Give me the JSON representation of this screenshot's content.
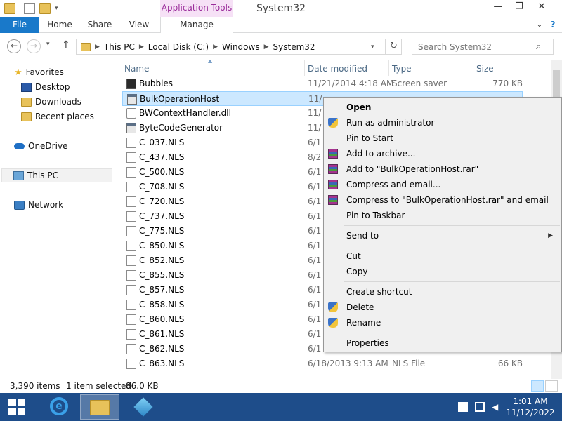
{
  "window": {
    "title": "System32",
    "app_tools": "Application Tools",
    "min_glyph": "—",
    "max_glyph": "❐",
    "close_glyph": "✕"
  },
  "ribbon": {
    "tabs": [
      "File",
      "Home",
      "Share",
      "View",
      "Manage"
    ],
    "help_glyph": "?"
  },
  "nav": {
    "back_glyph": "←",
    "forward_glyph": "→",
    "recent_glyph": "▾",
    "up_glyph": "↑",
    "breadcrumbs": [
      "This PC",
      "Local Disk (C:)",
      "Windows",
      "System32"
    ],
    "refresh_glyph": "↻",
    "search_placeholder": "Search System32"
  },
  "navpane": {
    "favorites": "Favorites",
    "desktop": "Desktop",
    "downloads": "Downloads",
    "recent_places": "Recent places",
    "onedrive": "OneDrive",
    "this_pc": "This PC",
    "network": "Network"
  },
  "columns": {
    "name": "Name",
    "date": "Date modified",
    "type": "Type",
    "size": "Size"
  },
  "files": [
    {
      "name": "Bubbles",
      "date": "11/21/2014 4:18 AM",
      "type": "Screen saver",
      "size": "770 KB",
      "icon": "scr"
    },
    {
      "name": "BulkOperationHost",
      "date": "11/",
      "type": "",
      "size": "",
      "icon": "app"
    },
    {
      "name": "BWContextHandler.dll",
      "date": "11/",
      "type": "",
      "size": "",
      "icon": "dll"
    },
    {
      "name": "ByteCodeGenerator",
      "date": "11/",
      "type": "",
      "size": "",
      "icon": "app"
    },
    {
      "name": "C_037.NLS",
      "date": "6/1",
      "type": "",
      "size": "",
      "icon": "doc"
    },
    {
      "name": "C_437.NLS",
      "date": "8/2",
      "type": "",
      "size": "",
      "icon": "doc"
    },
    {
      "name": "C_500.NLS",
      "date": "6/1",
      "type": "",
      "size": "",
      "icon": "doc"
    },
    {
      "name": "C_708.NLS",
      "date": "6/1",
      "type": "",
      "size": "",
      "icon": "doc"
    },
    {
      "name": "C_720.NLS",
      "date": "6/1",
      "type": "",
      "size": "",
      "icon": "doc"
    },
    {
      "name": "C_737.NLS",
      "date": "6/1",
      "type": "",
      "size": "",
      "icon": "doc"
    },
    {
      "name": "C_775.NLS",
      "date": "6/1",
      "type": "",
      "size": "",
      "icon": "doc"
    },
    {
      "name": "C_850.NLS",
      "date": "6/1",
      "type": "",
      "size": "",
      "icon": "doc"
    },
    {
      "name": "C_852.NLS",
      "date": "6/1",
      "type": "",
      "size": "",
      "icon": "doc"
    },
    {
      "name": "C_855.NLS",
      "date": "6/1",
      "type": "",
      "size": "",
      "icon": "doc"
    },
    {
      "name": "C_857.NLS",
      "date": "6/1",
      "type": "",
      "size": "",
      "icon": "doc"
    },
    {
      "name": "C_858.NLS",
      "date": "6/1",
      "type": "",
      "size": "",
      "icon": "doc"
    },
    {
      "name": "C_860.NLS",
      "date": "6/1",
      "type": "",
      "size": "",
      "icon": "doc"
    },
    {
      "name": "C_861.NLS",
      "date": "6/1",
      "type": "",
      "size": "",
      "icon": "doc"
    },
    {
      "name": "C_862.NLS",
      "date": "6/1",
      "type": "",
      "size": "",
      "icon": "doc"
    },
    {
      "name": "C_863.NLS",
      "date": "6/18/2013 9:13 AM",
      "type": "NLS File",
      "size": "66 KB",
      "icon": "doc"
    }
  ],
  "selected_index": 1,
  "status": {
    "items": "3,390 items",
    "selected": "1 item selected",
    "size": "86.0 KB"
  },
  "context_menu": {
    "open": "Open",
    "run_admin": "Run as administrator",
    "pin_start": "Pin to Start",
    "add_archive": "Add to archive...",
    "add_rar": "Add to \"BulkOperationHost.rar\"",
    "compress_email": "Compress and email...",
    "compress_rar_email": "Compress to \"BulkOperationHost.rar\" and email",
    "pin_taskbar": "Pin to Taskbar",
    "send_to": "Send to",
    "cut": "Cut",
    "copy": "Copy",
    "create_shortcut": "Create shortcut",
    "delete": "Delete",
    "rename": "Rename",
    "properties": "Properties",
    "submenu_glyph": "▶"
  },
  "taskbar": {
    "time": "1:01 AM",
    "date": "11/12/2022"
  },
  "colors": {
    "accent": "#1979ca",
    "selection": "#cce8ff",
    "taskbar": "#1e4d8a",
    "app_tools": "#f6e1f6"
  }
}
